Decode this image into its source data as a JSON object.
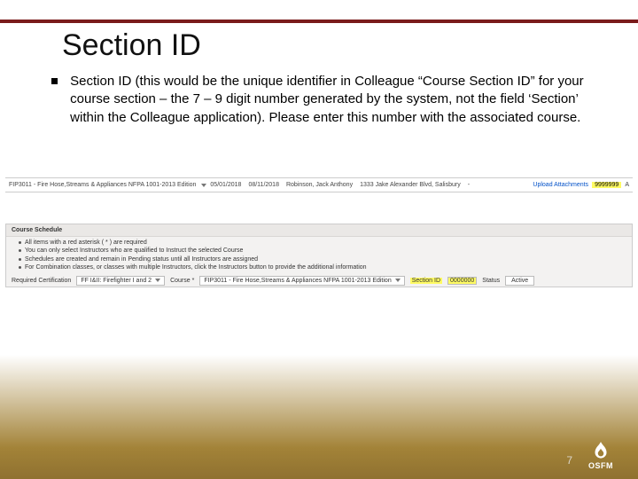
{
  "title": "Section ID",
  "body": "Section ID (this would be the unique identifier in Colleague “Course Section ID” for your course section – the 7 – 9 digit number generated by the system, not the field ‘Section’ within the Colleague application). Please enter this number with the associated course.",
  "shot1": {
    "course": "FIP3011 - Fire Hose,Streams & Appliances NFPA 1001-2013 Edition",
    "start": "05/01/2018",
    "end": "08/11/2018",
    "instructor": "Robinson, Jack Anthony",
    "location": "1333 Jake Alexander Blvd, Salisbury",
    "upload": "Upload Attachments",
    "id": "9999999"
  },
  "shot2": {
    "header": "Course Schedule",
    "n1": "All items with a red asterisk ( * ) are required",
    "n2": "You can only select Instructors who are qualified to Instruct the selected Course",
    "n3": "Schedules are created and remain in Pending status until all Instructors are assigned",
    "n4": "For Combination classes, or classes with multiple Instructors, click the Instructors button to provide the additional information",
    "labelCert": "Required Certification",
    "valCert": "FF I&II: Firefighter I and 2",
    "labelCourse": "Course *",
    "valCourse": "FIP3011 - Fire Hose,Streams & Appliances NFPA 1001-2013 Edition",
    "labelSection": "Section ID",
    "valSection": "0000000",
    "labelStatus": "Status",
    "valStatus": "Active"
  },
  "pageNumber": "7",
  "logoText": "OSFM"
}
